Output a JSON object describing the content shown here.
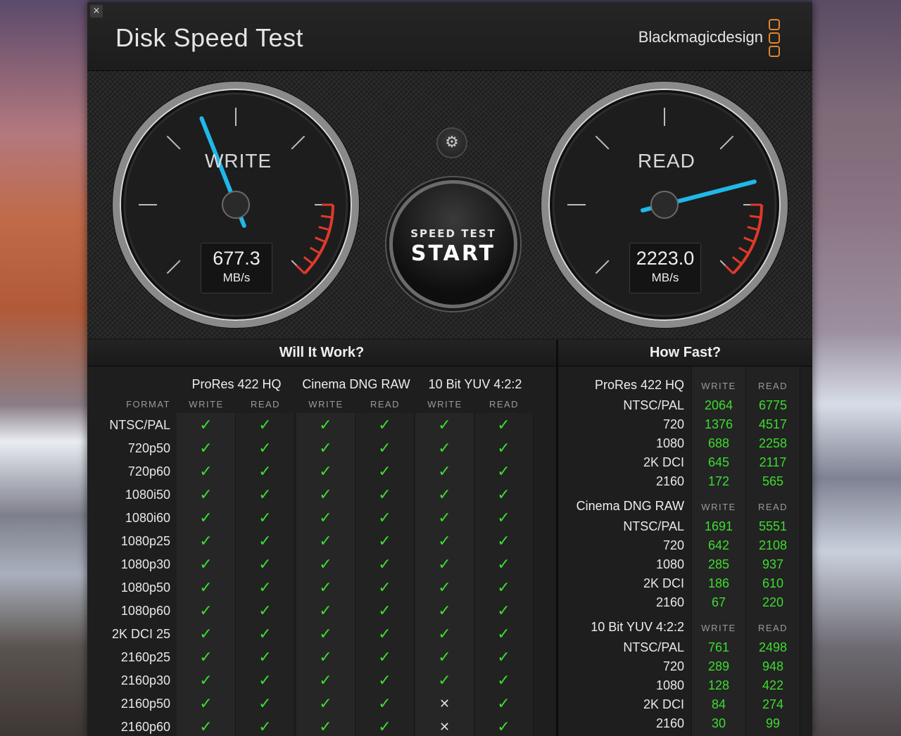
{
  "window": {
    "title": "Disk Speed Test",
    "brand": "Blackmagicdesign",
    "close_glyph": "×"
  },
  "gauges": {
    "write": {
      "label": "WRITE",
      "value": "677.3",
      "unit": "MB/s",
      "needle_fraction": 0.42
    },
    "read": {
      "label": "READ",
      "value": "2223.0",
      "unit": "MB/s",
      "needle_fraction": 0.78
    }
  },
  "controls": {
    "settings_icon": "gear-icon",
    "settings_glyph": "⚙",
    "start_top": "SPEED TEST",
    "start_main": "START"
  },
  "will_it_work": {
    "title": "Will It Work?",
    "format_header": "FORMAT",
    "write_label": "WRITE",
    "read_label": "READ",
    "groups": [
      "ProRes 422 HQ",
      "Cinema DNG RAW",
      "10 Bit YUV 4:2:2"
    ],
    "rows": [
      {
        "format": "NTSC/PAL",
        "cells": [
          "ok",
          "ok",
          "ok",
          "ok",
          "ok",
          "ok"
        ]
      },
      {
        "format": "720p50",
        "cells": [
          "ok",
          "ok",
          "ok",
          "ok",
          "ok",
          "ok"
        ]
      },
      {
        "format": "720p60",
        "cells": [
          "ok",
          "ok",
          "ok",
          "ok",
          "ok",
          "ok"
        ]
      },
      {
        "format": "1080i50",
        "cells": [
          "ok",
          "ok",
          "ok",
          "ok",
          "ok",
          "ok"
        ]
      },
      {
        "format": "1080i60",
        "cells": [
          "ok",
          "ok",
          "ok",
          "ok",
          "ok",
          "ok"
        ]
      },
      {
        "format": "1080p25",
        "cells": [
          "ok",
          "ok",
          "ok",
          "ok",
          "ok",
          "ok"
        ]
      },
      {
        "format": "1080p30",
        "cells": [
          "ok",
          "ok",
          "ok",
          "ok",
          "ok",
          "ok"
        ]
      },
      {
        "format": "1080p50",
        "cells": [
          "ok",
          "ok",
          "ok",
          "ok",
          "ok",
          "ok"
        ]
      },
      {
        "format": "1080p60",
        "cells": [
          "ok",
          "ok",
          "ok",
          "ok",
          "ok",
          "ok"
        ]
      },
      {
        "format": "2K DCI 25",
        "cells": [
          "ok",
          "ok",
          "ok",
          "ok",
          "ok",
          "ok"
        ]
      },
      {
        "format": "2160p25",
        "cells": [
          "ok",
          "ok",
          "ok",
          "ok",
          "ok",
          "ok"
        ]
      },
      {
        "format": "2160p30",
        "cells": [
          "ok",
          "ok",
          "ok",
          "ok",
          "ok",
          "ok"
        ]
      },
      {
        "format": "2160p50",
        "cells": [
          "ok",
          "ok",
          "ok",
          "ok",
          "no",
          "ok"
        ]
      },
      {
        "format": "2160p60",
        "cells": [
          "ok",
          "ok",
          "ok",
          "ok",
          "no",
          "ok"
        ]
      }
    ]
  },
  "how_fast": {
    "title": "How Fast?",
    "write_label": "WRITE",
    "read_label": "READ",
    "groups": [
      {
        "name": "ProRes 422 HQ",
        "rows": [
          {
            "format": "NTSC/PAL",
            "write": "2064",
            "read": "6775"
          },
          {
            "format": "720",
            "write": "1376",
            "read": "4517"
          },
          {
            "format": "1080",
            "write": "688",
            "read": "2258"
          },
          {
            "format": "2K DCI",
            "write": "645",
            "read": "2117"
          },
          {
            "format": "2160",
            "write": "172",
            "read": "565"
          }
        ]
      },
      {
        "name": "Cinema DNG RAW",
        "rows": [
          {
            "format": "NTSC/PAL",
            "write": "1691",
            "read": "5551"
          },
          {
            "format": "720",
            "write": "642",
            "read": "2108"
          },
          {
            "format": "1080",
            "write": "285",
            "read": "937"
          },
          {
            "format": "2K DCI",
            "write": "186",
            "read": "610"
          },
          {
            "format": "2160",
            "write": "67",
            "read": "220"
          }
        ]
      },
      {
        "name": "10 Bit YUV 4:2:2",
        "rows": [
          {
            "format": "NTSC/PAL",
            "write": "761",
            "read": "2498"
          },
          {
            "format": "720",
            "write": "289",
            "read": "948"
          },
          {
            "format": "1080",
            "write": "128",
            "read": "422"
          },
          {
            "format": "2K DCI",
            "write": "84",
            "read": "274"
          },
          {
            "format": "2160",
            "write": "30",
            "read": "99"
          }
        ]
      }
    ]
  },
  "colors": {
    "accent": "#1fb8e8",
    "check": "#3ddc2f",
    "redzone": "#e0392b",
    "brand": "#e0862e"
  }
}
